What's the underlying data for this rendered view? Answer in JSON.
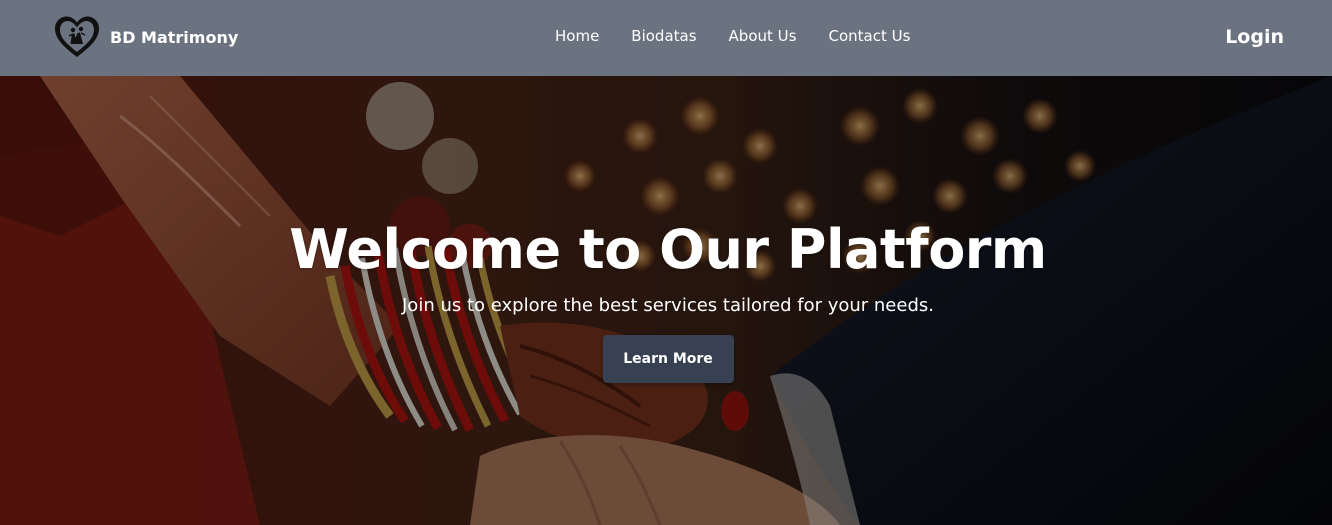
{
  "navbar": {
    "brand_name": "BD Matrimony",
    "links": [
      {
        "label": "Home"
      },
      {
        "label": "Biodatas"
      },
      {
        "label": "About Us"
      },
      {
        "label": "Contact Us"
      }
    ],
    "login_label": "Login",
    "background_color": "#6b7280"
  },
  "hero": {
    "title": "Welcome to Our Platform",
    "subtitle": "Join us to explore the best services tailored for your needs.",
    "button_label": "Learn More",
    "button_color": "#374151",
    "background_image": "wedding-handshake-photo"
  }
}
